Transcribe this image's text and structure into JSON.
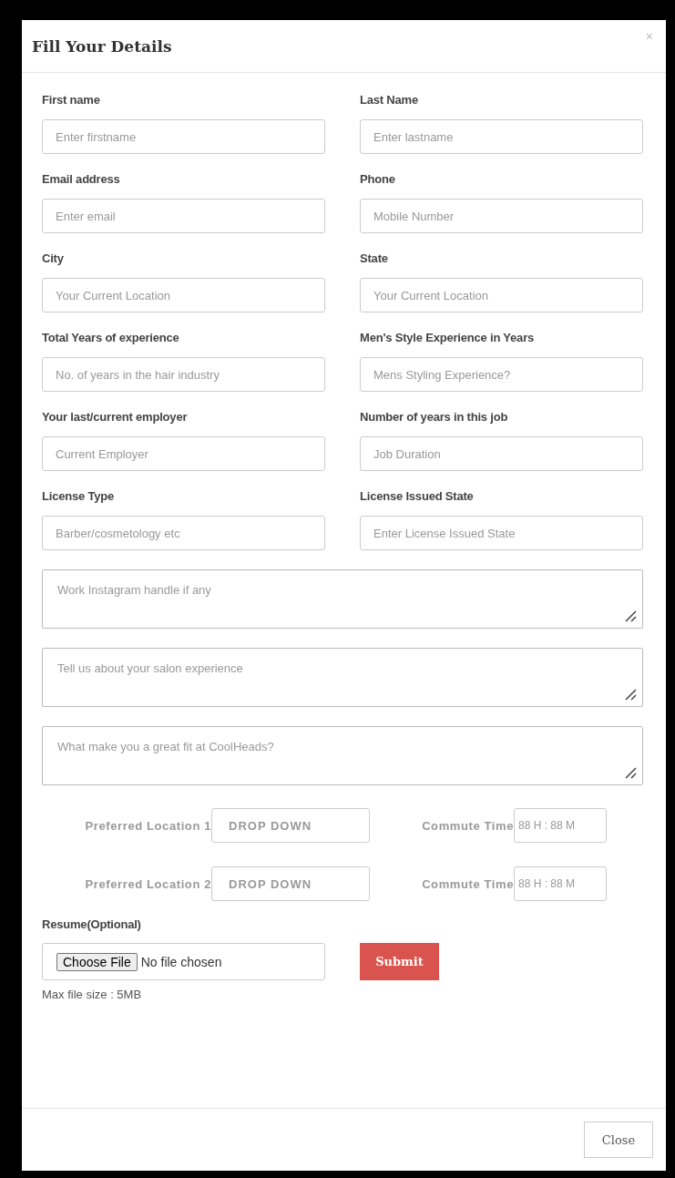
{
  "modal": {
    "title": "Fill Your Details",
    "close_icon": "×"
  },
  "fields": [
    {
      "label": "First name",
      "placeholder": "Enter firstname"
    },
    {
      "label": "Last Name",
      "placeholder": "Enter lastname"
    },
    {
      "label": "Email address",
      "placeholder": "Enter email"
    },
    {
      "label": "Phone",
      "placeholder": "Mobile Number"
    },
    {
      "label": "City",
      "placeholder": "Your Current Location"
    },
    {
      "label": "State",
      "placeholder": "Your Current Location"
    },
    {
      "label": "Total Years of experience",
      "placeholder": "No. of years in the hair industry"
    },
    {
      "label": "Men's Style Experience in Years",
      "placeholder": "Mens Styling Experience?"
    },
    {
      "label": "Your last/current employer",
      "placeholder": "Current Employer"
    },
    {
      "label": "Number of years in this job",
      "placeholder": "Job Duration"
    },
    {
      "label": "License Type",
      "placeholder": "Barber/cosmetology etc"
    },
    {
      "label": "License Issued State",
      "placeholder": "Enter License Issued State"
    }
  ],
  "textareas": [
    {
      "placeholder": "Work Instagram handle if any"
    },
    {
      "placeholder": "Tell us about your salon experience"
    },
    {
      "placeholder": "What make you a great fit at CoolHeads?"
    }
  ],
  "locations": [
    {
      "label": "Preferred Location 1",
      "dropdown": "DROP DOWN",
      "commute_label": "Commute Time",
      "commute": "88 H : 88 M"
    },
    {
      "label": "Preferred Location 2",
      "dropdown": "DROP DOWN",
      "commute_label": "Commute Time",
      "commute": "88 H : 88 M"
    }
  ],
  "resume": {
    "label": "Resume(Optional)",
    "button": "Choose File",
    "status": "No file chosen",
    "hint": "Max file size : 5MB"
  },
  "submit": "Submit",
  "footer": {
    "close": "Close"
  }
}
